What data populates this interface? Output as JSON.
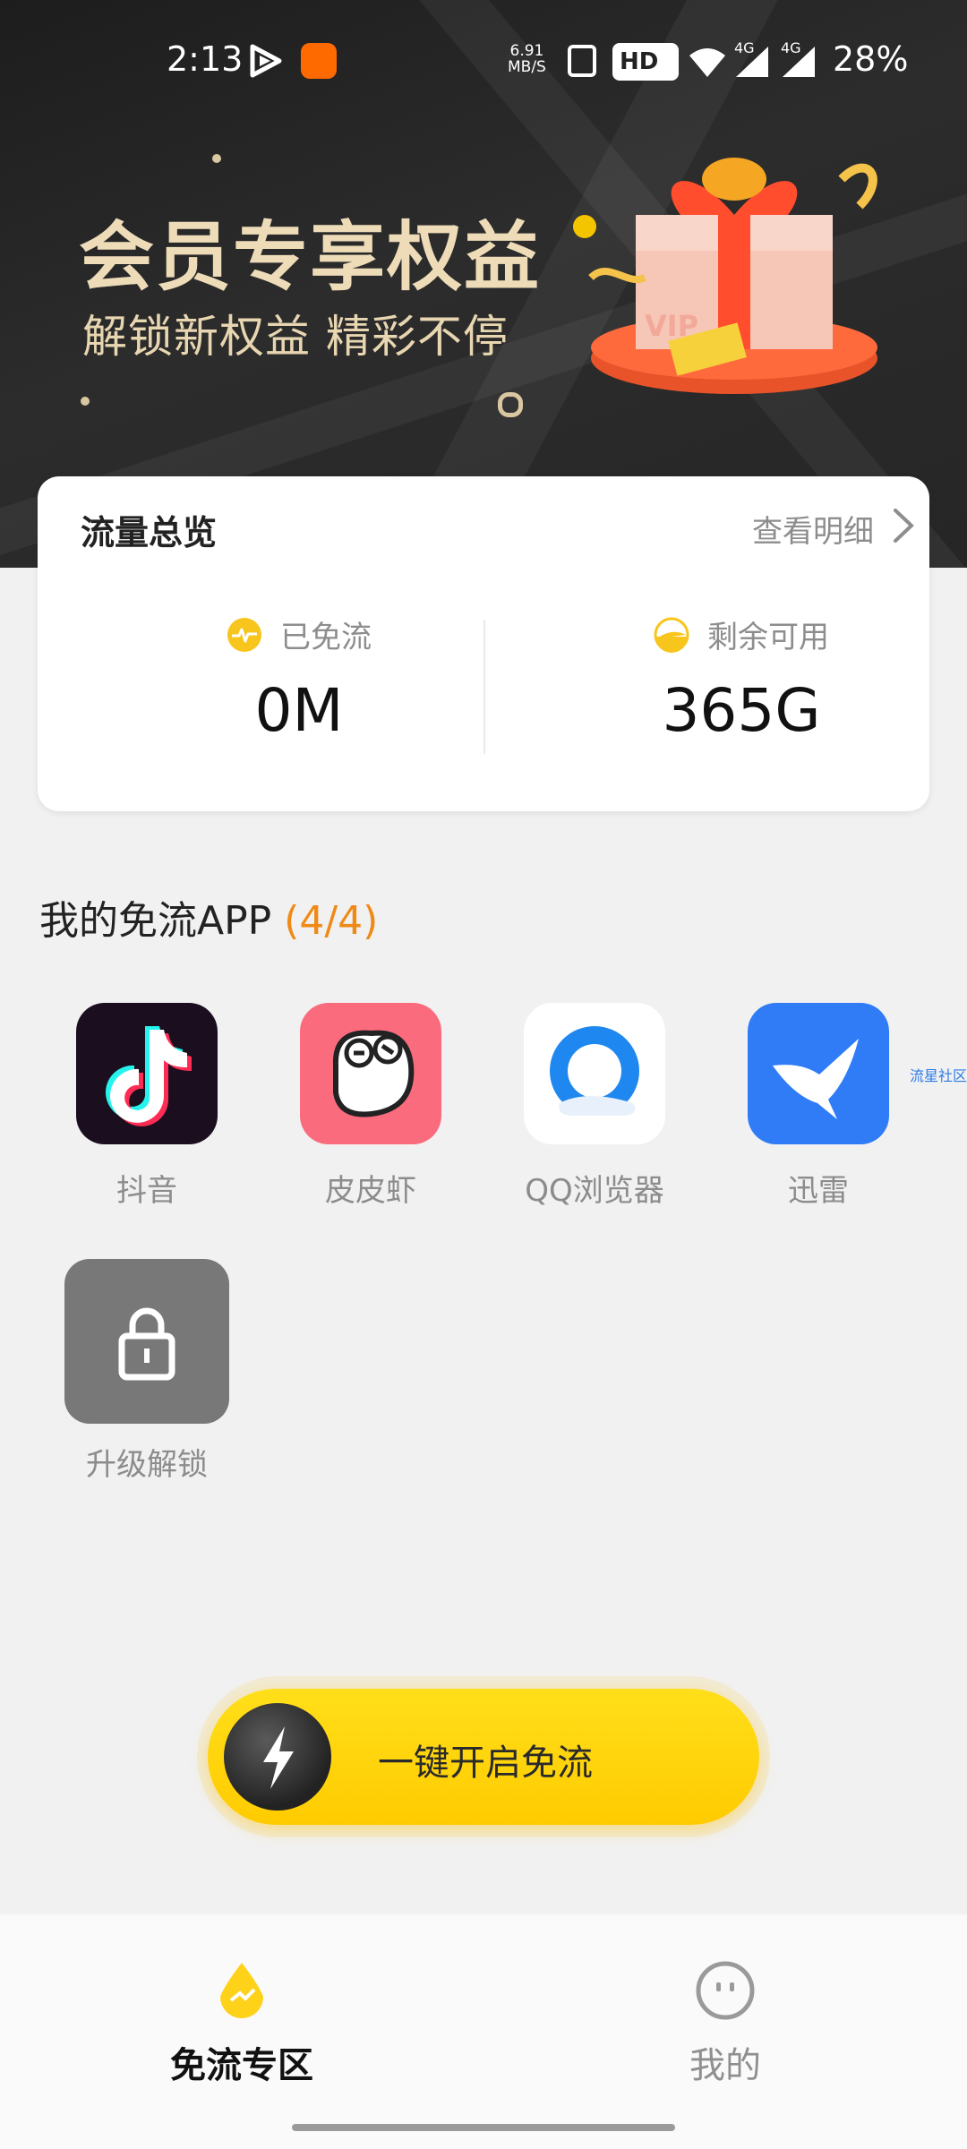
{
  "status_bar": {
    "time": "2:13",
    "speed_value": "6.91",
    "speed_unit": "MB/S",
    "hd_label": "HD",
    "network_1": "4G",
    "network_2": "4G",
    "battery": "28%"
  },
  "banner": {
    "title": "会员专享权益",
    "subtitle": "解锁新权益  精彩不停",
    "gift_label": "VIP"
  },
  "overview": {
    "title": "流量总览",
    "detail_link": "查看明细",
    "used_label": "已免流",
    "used_value": "0M",
    "remaining_label": "剩余可用",
    "remaining_value": "365G"
  },
  "apps_section": {
    "heading": "我的免流APP",
    "count": "(4/4)",
    "apps": [
      {
        "label": "抖音",
        "icon": "douyin-icon"
      },
      {
        "label": "皮皮虾",
        "icon": "pipixia-icon"
      },
      {
        "label": "QQ浏览器",
        "icon": "qq-browser-icon"
      },
      {
        "label": "迅雷",
        "icon": "xunlei-icon"
      }
    ],
    "unlock_label": "升级解锁",
    "side_tag": "流星社区"
  },
  "cta": {
    "label": "一键开启免流"
  },
  "bottom_nav": {
    "items": [
      {
        "label": "免流专区",
        "icon": "free-zone-icon",
        "active": true
      },
      {
        "label": "我的",
        "icon": "profile-icon",
        "active": false
      }
    ]
  },
  "colors": {
    "accent_yellow": "#ffd400",
    "count_orange": "#ef8a17",
    "banner_gold": "#eedcb9"
  }
}
